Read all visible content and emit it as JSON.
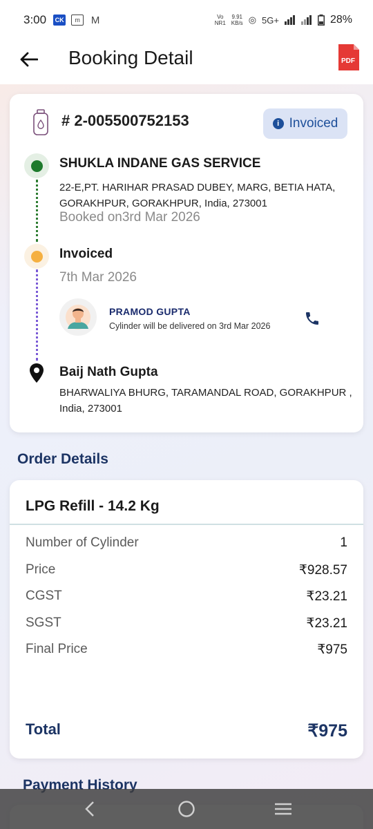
{
  "status_bar": {
    "time": "3:00",
    "left_icons": [
      "CK",
      "m",
      "M"
    ],
    "volte_top": "Vo",
    "volte_bottom": "NR1",
    "net_speed_top": "9.91",
    "net_speed_bottom": "KB/s",
    "network": "5G+",
    "battery": "28%"
  },
  "header": {
    "title": "Booking Detail",
    "pdf_label": "PDF"
  },
  "booking": {
    "id": "# 2-005500752153",
    "status": "Invoiced",
    "distributor": {
      "name": "SHUKLA INDANE GAS SERVICE",
      "address": "22-E,PT. HARIHAR PRASAD DUBEY, MARG, BETIA HATA, GORAKHPUR, GORAKHPUR, India, 273001",
      "booked_on": "Booked on3rd Mar 2026"
    },
    "invoice": {
      "title": "Invoiced",
      "date": "7th Mar 2026"
    },
    "delivery_agent": {
      "name": "PRAMOD GUPTA",
      "note": "Cylinder will be delivered on 3rd Mar 2026"
    },
    "customer": {
      "name": "Baij Nath Gupta",
      "address": "BHARWALIYA BHURG, TARAMANDAL ROAD, GORAKHPUR , India, 273001"
    }
  },
  "order": {
    "section_title": "Order Details",
    "product": "LPG Refill - 14.2 Kg",
    "rows": [
      {
        "label": "Number of Cylinder",
        "value": "1"
      },
      {
        "label": "Price",
        "value": "₹928.57"
      },
      {
        "label": "CGST",
        "value": "₹23.21"
      },
      {
        "label": "SGST",
        "value": "₹23.21"
      },
      {
        "label": "Final Price",
        "value": "₹975"
      }
    ],
    "total_label": "Total",
    "total_value": "₹975"
  },
  "payment": {
    "section_title": "Payment History"
  },
  "colors": {
    "accent_navy": "#1c3464",
    "chip_bg": "#dbe3f5",
    "green": "#1e7a2c",
    "orange": "#f5b041",
    "pdf_red": "#e53935"
  }
}
